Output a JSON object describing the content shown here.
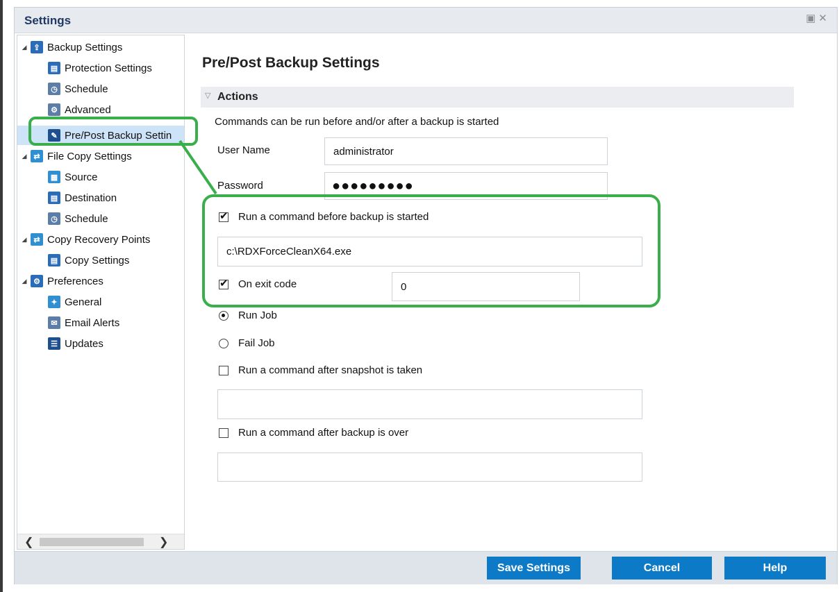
{
  "window": {
    "title": "Settings"
  },
  "sidebar": {
    "items": [
      {
        "label": "Backup Settings",
        "icon": "backup-icon"
      },
      {
        "label": "Protection Settings",
        "icon": "protection-icon"
      },
      {
        "label": "Schedule",
        "icon": "schedule-icon"
      },
      {
        "label": "Advanced",
        "icon": "advanced-icon"
      },
      {
        "label": "Pre/Post Backup Settin",
        "icon": "wrench-icon"
      },
      {
        "label": "File Copy Settings",
        "icon": "file-copy-icon"
      },
      {
        "label": "Source",
        "icon": "source-icon"
      },
      {
        "label": "Destination",
        "icon": "destination-icon"
      },
      {
        "label": "Schedule",
        "icon": "schedule-icon"
      },
      {
        "label": "Copy Recovery Points",
        "icon": "copy-recovery-icon"
      },
      {
        "label": "Copy Settings",
        "icon": "copy-settings-icon"
      },
      {
        "label": "Preferences",
        "icon": "preferences-icon"
      },
      {
        "label": "General",
        "icon": "general-icon"
      },
      {
        "label": "Email Alerts",
        "icon": "email-icon"
      },
      {
        "label": "Updates",
        "icon": "updates-icon"
      }
    ]
  },
  "main": {
    "title": "Pre/Post Backup Settings",
    "section": "Actions",
    "description": "Commands can be run before and/or after a backup is started",
    "username_label": "User Name",
    "username_value": "administrator",
    "password_label": "Password",
    "password_value": "●●●●●●●●●",
    "run_before_label": "Run a command before backup is started",
    "run_before_checked": true,
    "run_before_value": "c:\\RDXForceCleanX64.exe",
    "exit_code_label": "On exit code",
    "exit_code_checked": true,
    "exit_code_value": "0",
    "run_job_label": "Run Job",
    "fail_job_label": "Fail Job",
    "after_snapshot_label": "Run a command after snapshot is taken",
    "after_backup_label": "Run a command after backup is over"
  },
  "footer": {
    "save_label": "Save Settings",
    "cancel_label": "Cancel",
    "help_label": "Help"
  },
  "colors": {
    "accent": "#0d7ac8",
    "annotation": "#3aae4a",
    "title": "#1f3864"
  }
}
